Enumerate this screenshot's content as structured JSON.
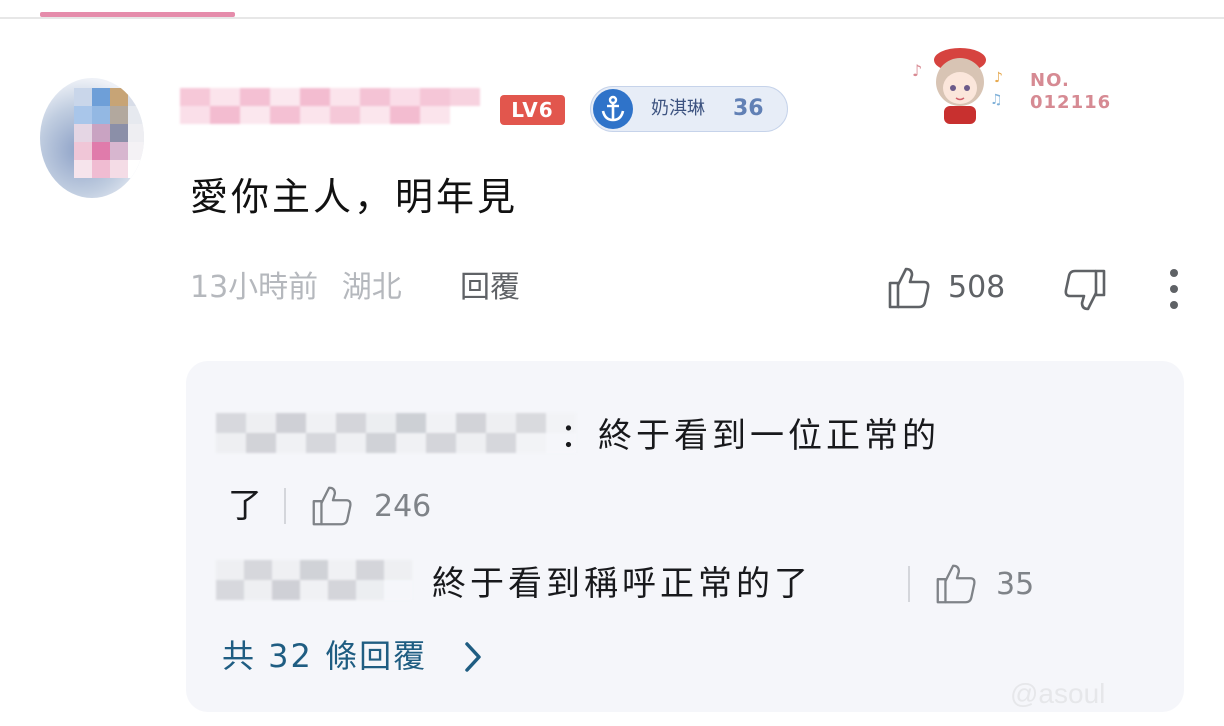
{
  "colors": {
    "tab_indicator": "#e58cab",
    "level_badge": "#e2564d",
    "fan_badge_icon": "#2f73c9",
    "reply_link": "#1f5d82",
    "reply_box_bg": "#f5f6fa"
  },
  "comment": {
    "level": "LV6",
    "fan_badge": {
      "name": "奶淇琳",
      "level": "36",
      "icon": "anchor-icon"
    },
    "decoration": {
      "number_label": "NO.",
      "number": "012116"
    },
    "text": "愛你主人，明年見",
    "time": "13小時前",
    "location": "湖北",
    "reply_label": "回覆",
    "likes": "508"
  },
  "replies": [
    {
      "separator": "：",
      "text_line1": "終于看到一位正常的",
      "text_line2": "了",
      "likes": "246"
    },
    {
      "text": "終于看到稱呼正常的了",
      "likes": "35"
    }
  ],
  "more_replies": {
    "label": "共 32 條回覆"
  },
  "watermark": "@asoul"
}
